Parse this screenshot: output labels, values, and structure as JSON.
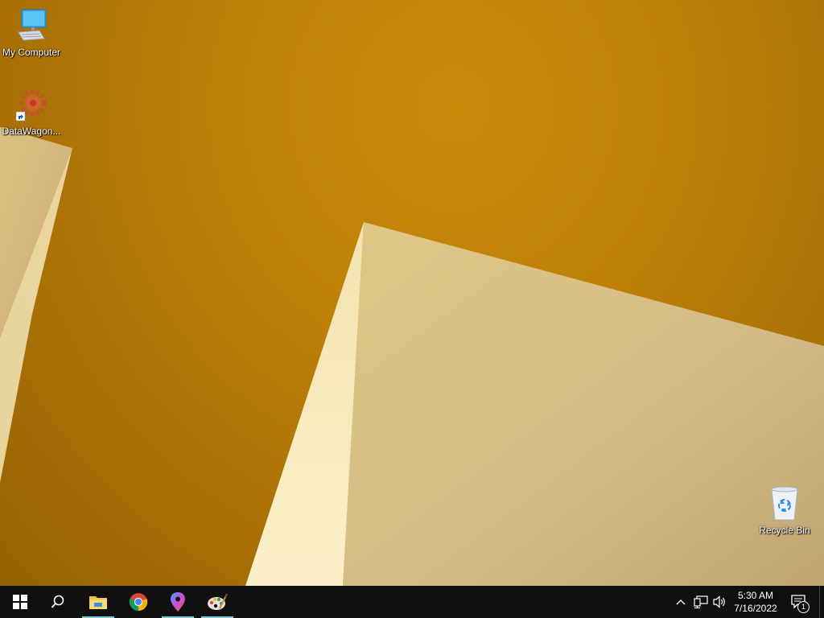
{
  "desktop": {
    "icons": [
      {
        "label": "My Computer",
        "icon": "monitor-icon"
      },
      {
        "label": "DataWagon...",
        "icon": "datawagon-gear-icon"
      },
      {
        "label": "Recycle Bin",
        "icon": "recycle-bin-icon"
      }
    ]
  },
  "taskbar": {
    "pinned": [
      {
        "name": "start",
        "icon": "windows-logo-icon"
      },
      {
        "name": "search",
        "icon": "search-icon"
      },
      {
        "name": "file-explorer",
        "icon": "folder-icon",
        "active": true
      },
      {
        "name": "chrome",
        "icon": "chrome-icon",
        "active": false
      },
      {
        "name": "maps",
        "icon": "map-pin-icon",
        "active": true
      },
      {
        "name": "paint",
        "icon": "paint-palette-icon",
        "active": true
      }
    ],
    "tray": {
      "time": "5:30 AM",
      "date": "7/16/2022",
      "notification_count": "1"
    }
  },
  "colors": {
    "wallpaper": "#bf8008",
    "taskbar": "#101010",
    "active_indicator": "#7cc7d8"
  }
}
